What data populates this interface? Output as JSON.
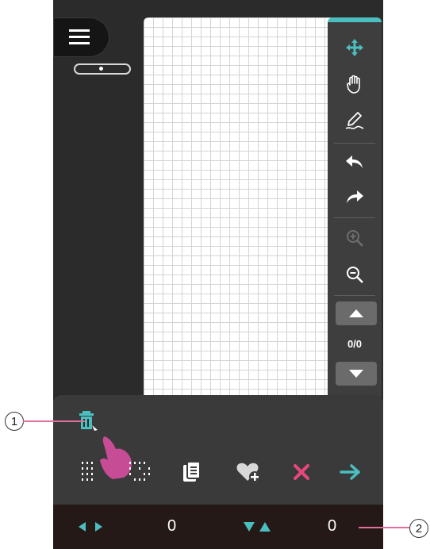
{
  "toolbar": {
    "page_counter": "0/0"
  },
  "status": {
    "horizontal_value": "0",
    "vertical_value": "0"
  },
  "callouts": {
    "first": "1",
    "second": "2"
  },
  "colors": {
    "accent": "#4bbfc0",
    "delete": "#e8467e",
    "hand": "#c64c95"
  },
  "icons": [
    "menu-icon",
    "move-icon",
    "hand-icon",
    "pen-icon",
    "undo-icon",
    "redo-icon",
    "zoom-in-icon",
    "zoom-out-icon",
    "page-up-icon",
    "page-down-icon",
    "delete-stitch-icon",
    "stitch-grid-icon",
    "selection-icon",
    "copy-icon",
    "heart-add-icon",
    "cancel-icon",
    "next-icon"
  ]
}
